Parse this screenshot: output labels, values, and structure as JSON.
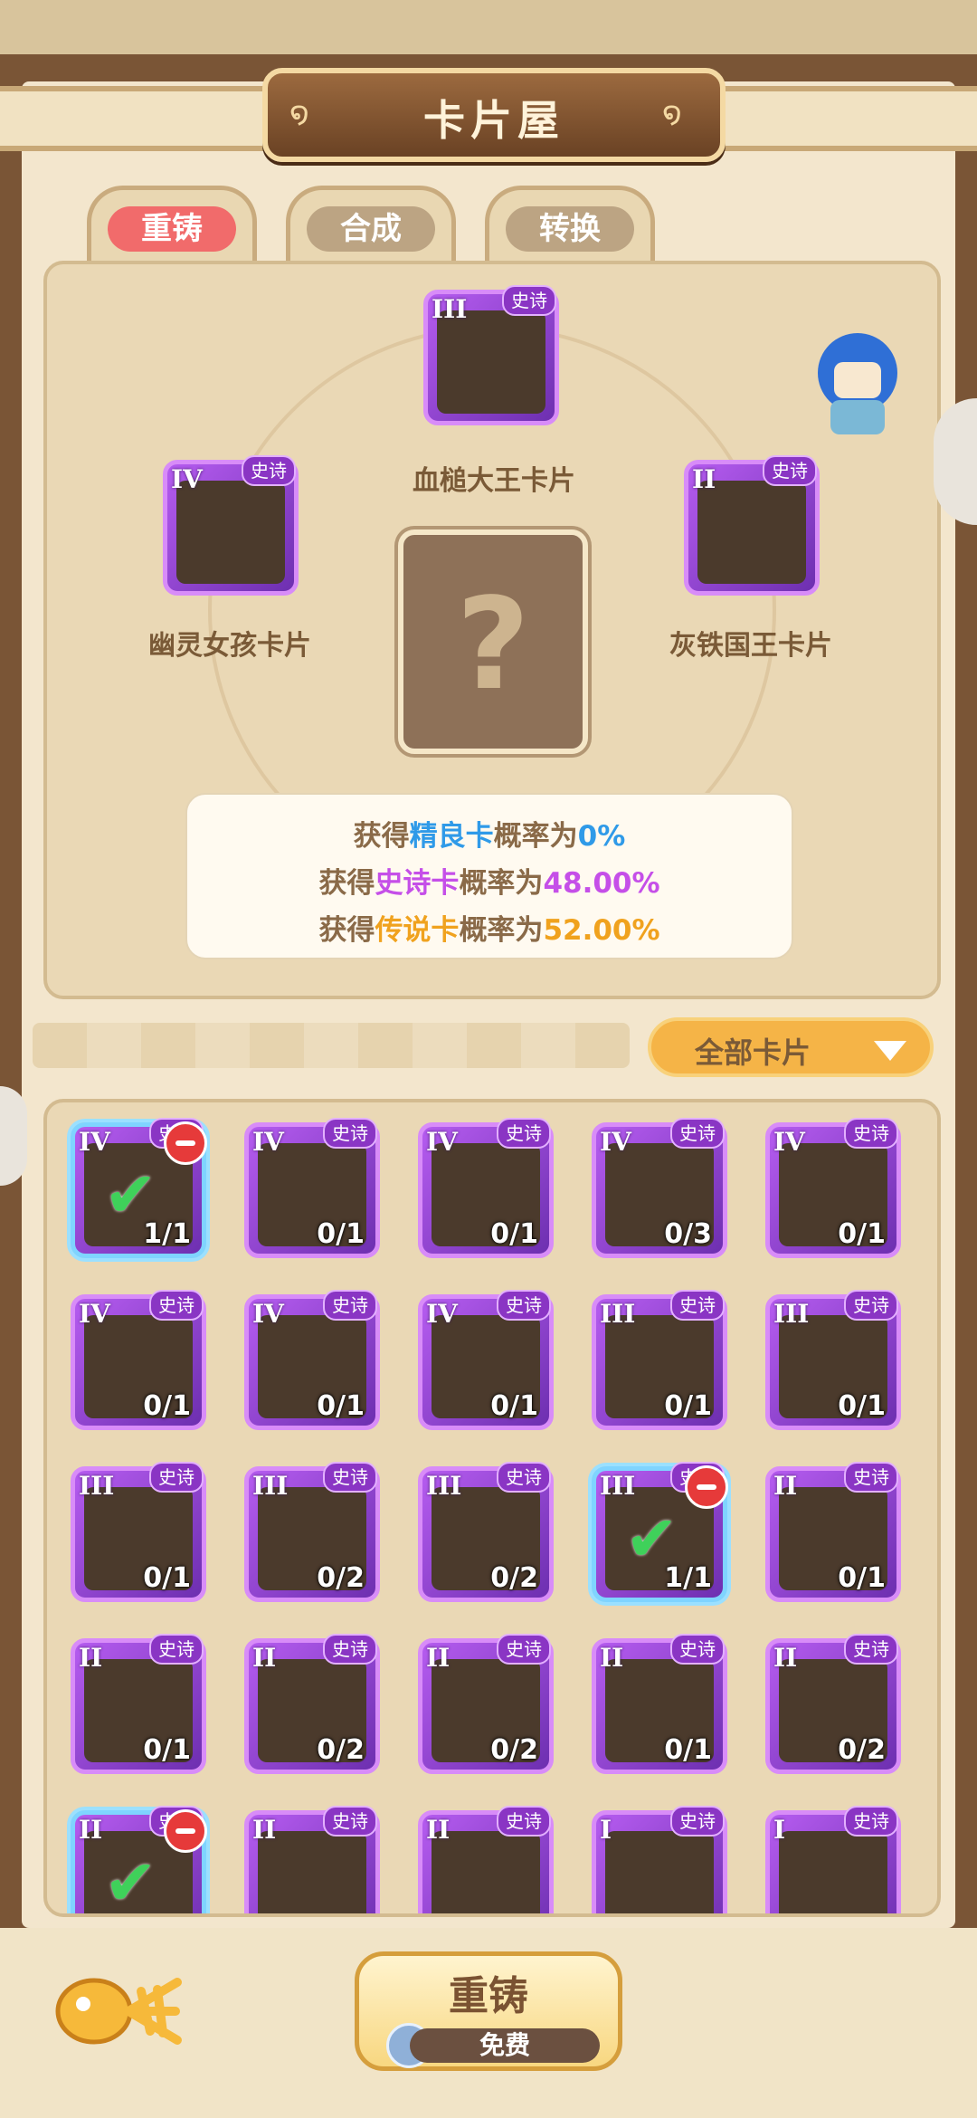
{
  "header": {
    "title": "卡片屋"
  },
  "tabs": [
    {
      "label": "重铸",
      "active": true
    },
    {
      "label": "合成",
      "active": false
    },
    {
      "label": "转换",
      "active": false
    }
  ],
  "slots": {
    "top": {
      "tier": "III",
      "rarity": "史诗",
      "name": "血槌大王卡片"
    },
    "left": {
      "tier": "IV",
      "rarity": "史诗",
      "name": "幽灵女孩卡片"
    },
    "right": {
      "tier": "II",
      "rarity": "史诗",
      "name": "灰铁国王卡片"
    },
    "result": "?"
  },
  "probabilities": {
    "line1": {
      "prefix": "获得",
      "type": "精良卡",
      "mid": "概率为",
      "value": "0%"
    },
    "line2": {
      "prefix": "获得",
      "type": "史诗卡",
      "mid": "概率为",
      "value": "48.00%"
    },
    "line3": {
      "prefix": "获得",
      "type": "传说卡",
      "mid": "概率为",
      "value": "52.00%"
    }
  },
  "filter": {
    "label": "全部卡片"
  },
  "cards": [
    {
      "tier": "IV",
      "rarity": "史诗",
      "count": "1/1",
      "selected": true
    },
    {
      "tier": "IV",
      "rarity": "史诗",
      "count": "0/1",
      "selected": false
    },
    {
      "tier": "IV",
      "rarity": "史诗",
      "count": "0/1",
      "selected": false
    },
    {
      "tier": "IV",
      "rarity": "史诗",
      "count": "0/3",
      "selected": false
    },
    {
      "tier": "IV",
      "rarity": "史诗",
      "count": "0/1",
      "selected": false
    },
    {
      "tier": "IV",
      "rarity": "史诗",
      "count": "0/1",
      "selected": false
    },
    {
      "tier": "IV",
      "rarity": "史诗",
      "count": "0/1",
      "selected": false
    },
    {
      "tier": "IV",
      "rarity": "史诗",
      "count": "0/1",
      "selected": false
    },
    {
      "tier": "III",
      "rarity": "史诗",
      "count": "0/1",
      "selected": false
    },
    {
      "tier": "III",
      "rarity": "史诗",
      "count": "0/1",
      "selected": false
    },
    {
      "tier": "III",
      "rarity": "史诗",
      "count": "0/1",
      "selected": false
    },
    {
      "tier": "III",
      "rarity": "史诗",
      "count": "0/2",
      "selected": false
    },
    {
      "tier": "III",
      "rarity": "史诗",
      "count": "0/2",
      "selected": false
    },
    {
      "tier": "III",
      "rarity": "史诗",
      "count": "1/1",
      "selected": true
    },
    {
      "tier": "II",
      "rarity": "史诗",
      "count": "0/1",
      "selected": false
    },
    {
      "tier": "II",
      "rarity": "史诗",
      "count": "0/1",
      "selected": false
    },
    {
      "tier": "II",
      "rarity": "史诗",
      "count": "0/2",
      "selected": false
    },
    {
      "tier": "II",
      "rarity": "史诗",
      "count": "0/2",
      "selected": false
    },
    {
      "tier": "II",
      "rarity": "史诗",
      "count": "0/1",
      "selected": false
    },
    {
      "tier": "II",
      "rarity": "史诗",
      "count": "0/2",
      "selected": false
    },
    {
      "tier": "II",
      "rarity": "史诗",
      "count": "",
      "selected": true
    },
    {
      "tier": "II",
      "rarity": "史诗",
      "count": "",
      "selected": false
    },
    {
      "tier": "II",
      "rarity": "史诗",
      "count": "",
      "selected": false
    },
    {
      "tier": "I",
      "rarity": "史诗",
      "count": "",
      "selected": false
    },
    {
      "tier": "I",
      "rarity": "史诗",
      "count": "",
      "selected": false
    }
  ],
  "bottom": {
    "button_label": "重铸",
    "cost_label": "免费"
  },
  "colors": {
    "epic": "#8a35c4",
    "tab_active": "#f16b6b",
    "rare_blue": "#2f9ae8",
    "legend_orange": "#f0a21e"
  }
}
